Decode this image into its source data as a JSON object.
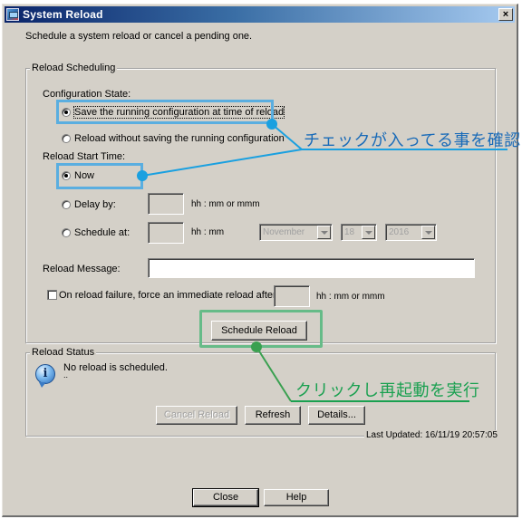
{
  "window": {
    "title": "System Reload",
    "close_label": "×",
    "description": "Schedule a system reload or cancel a pending one."
  },
  "scheduling": {
    "group_label": "Reload Scheduling",
    "config_state_label": "Configuration State:",
    "config_options": [
      {
        "label": "Save the running configuration at time of reload",
        "checked": true
      },
      {
        "label": "Reload without saving the running configuration",
        "checked": false
      }
    ],
    "start_time_label": "Reload Start Time:",
    "start_options": {
      "now": {
        "label": "Now",
        "checked": true
      },
      "delay": {
        "label": "Delay by:",
        "checked": false,
        "value": "",
        "hint": "hh : mm or mmm"
      },
      "schedule": {
        "label": "Schedule at:",
        "checked": false,
        "value": "",
        "hint": "hh : mm",
        "month": "November",
        "day": "18",
        "year": "2016"
      }
    },
    "message_label": "Reload Message:",
    "message_value": "",
    "force_reload": {
      "label": "On reload failure, force an immediate reload after:",
      "checked": false,
      "value": "",
      "hint": "hh : mm or mmm"
    },
    "schedule_button": "Schedule Reload"
  },
  "status": {
    "group_label": "Reload Status",
    "icon": "info-icon",
    "message": "No reload is scheduled.",
    "detail": "..",
    "cancel_button": "Cancel Reload",
    "refresh_button": "Refresh",
    "details_button": "Details...",
    "last_updated_label": "Last Updated:",
    "last_updated_value": "16/11/19 20:57:05"
  },
  "footer": {
    "close_button": "Close",
    "help_button": "Help"
  },
  "annotations": {
    "check_note": "チェックが入ってる事を確認",
    "check_color": "#1a6bb8",
    "click_note": "クリックし再起動を実行",
    "click_color": "#1aa050"
  }
}
